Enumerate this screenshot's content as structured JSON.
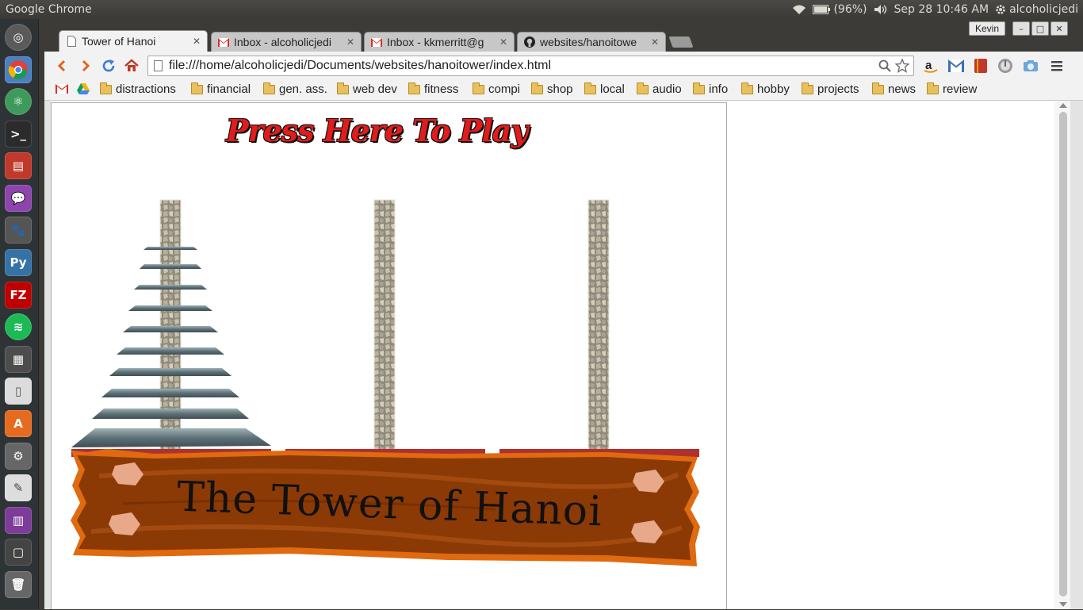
{
  "top_panel": {
    "app_title": "Google Chrome",
    "battery": "(96%)",
    "datetime": "Sep 28 10:46 AM",
    "user": "alcoholicjedi"
  },
  "launcher": {
    "items": [
      "dash-home",
      "chromium",
      "atom",
      "terminal",
      "files",
      "messaging",
      "gimp",
      "python",
      "filezilla",
      "spotify",
      "calculator",
      "libreoffice-document",
      "software-center",
      "system-settings",
      "text-editor",
      "workspaces",
      "other-window",
      "trash"
    ]
  },
  "chrome": {
    "profile": "Kevin",
    "tabs": [
      {
        "title": "Tower of Hanoi",
        "icon": "page-icon",
        "active": true
      },
      {
        "title": "Inbox - alcoholicjedi",
        "icon": "gmail-icon",
        "active": false
      },
      {
        "title": "Inbox - kkmerritt@g",
        "icon": "gmail-icon",
        "active": false
      },
      {
        "title": "websites/hanoitowe",
        "icon": "github-icon",
        "active": false
      }
    ],
    "url": "file:///home/alcoholicjedi/Documents/websites/hanoitower/index.html",
    "bookmarks": [
      "distractions",
      "financial",
      "gen. ass.",
      "web dev",
      "fitness",
      "compi",
      "shop",
      "local",
      "audio",
      "info",
      "hobby",
      "projects",
      "news",
      "review"
    ]
  },
  "game": {
    "play_button": "Press Here To Play",
    "sign_title": "The Tower of Hanoi",
    "disk_count": 10,
    "disks_on_peg": [
      10,
      0,
      0
    ],
    "colors": {
      "title_red": "#e21b1b",
      "peg_stone": "#b9b2a0",
      "disk_slate": "#5e7178",
      "base_red": "#b0302c",
      "sign_wood": "#8b3a05",
      "sign_border": "#e06a10",
      "sign_knot": "#e8a88a"
    }
  }
}
